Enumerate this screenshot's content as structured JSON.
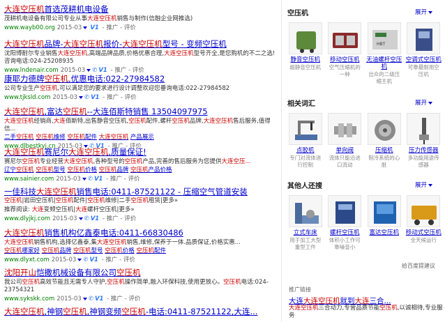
{
  "results": [
    {
      "title_parts": [
        "大连空压机",
        "首选茂耕机电设备"
      ],
      "title_hl": [
        0
      ],
      "desc_parts": [
        "茂耕机电设备有限公司专业从事",
        "大连空压机",
        "销售与制作(信融企业网推选)"
      ],
      "desc_hl": [
        1
      ],
      "url": "www.wayb00.org",
      "date": "2015-03",
      "v": "V1",
      "phone": false,
      "tools": [
        "推广",
        "评价"
      ],
      "links": []
    },
    {
      "title_parts": [
        "大连空压机",
        "品牌-",
        "大连空压机",
        "报价-",
        "大连空压机",
        "型号 - 变频空压机"
      ],
      "title_hl": [
        0,
        2,
        4
      ],
      "desc_parts": [
        "沈阳博耐尔专业销售",
        "大连空压机",
        ",高端品牌品质,价格优惠合理,",
        "大连空压机",
        "型号齐全,是您购机的不二之选!咨询电话:024-25208935"
      ],
      "desc_hl": [
        1,
        3
      ],
      "url": "www.lndenair.com",
      "date": "2015-03",
      "v": "V1",
      "phone": true,
      "tools": [
        "推广",
        "评价"
      ],
      "links": []
    },
    {
      "title_parts": [
        "康耶力德牌",
        "空压机",
        ",优惠电话:022-27984582"
      ],
      "title_hl": [
        1
      ],
      "desc_parts": [
        "公司专业生产",
        "空压机",
        ",可以满足您的要求进行设计调整欢迎您垂询电话:022-27984582"
      ],
      "desc_hl": [
        1
      ],
      "url": "www.tjksld.com",
      "date": "2015-03",
      "v": "V1",
      "phone": true,
      "tools": [
        "推广",
        "评价"
      ],
      "links": []
    },
    {
      "title_parts": [
        "大连空压机",
        ",富达",
        "空压机",
        "--大连佰斯特销售 13504097975"
      ],
      "title_hl": [
        0,
        2
      ],
      "desc_parts": [
        "大连空压机",
        "经销商,",
        "大连",
        "佰斯特,出售静音空压机,",
        "空压机",
        "配件,螺杆",
        "空压机",
        "品牌,",
        "大连空压机",
        "售后服务,值得信..."
      ],
      "desc_hl": [
        0,
        2,
        4,
        6,
        8
      ],
      "url": "www.dlbestkyj.cn",
      "date": "2015-03",
      "v": "V1",
      "phone": true,
      "tools": [
        "推广",
        "评价"
      ],
      "links": [
        [
          "二手",
          "空压机"
        ],
        [
          "空压机",
          "维修"
        ],
        [
          "空压机",
          "配件"
        ],
        [
          "大连空压机"
        ],
        [
          "产品展示"
        ]
      ]
    },
    {
      "title_parts": [
        "大连空压机",
        "赛尼尔",
        "大连空压机",
        ",质量保证!"
      ],
      "title_hl": [
        0,
        2
      ],
      "desc_parts": [
        "赛尼尔",
        "空压机",
        "专业经营",
        "大连空压机",
        ",各种型号的",
        "空压机",
        "产品,完善的售后服务为您提供",
        "大连空压..."
      ],
      "desc_hl": [
        1,
        3,
        5,
        7
      ],
      "url": "www.sainier.com",
      "date": "2015-03",
      "v": "V1",
      "phone": true,
      "tools": [
        "推广",
        "评价"
      ],
      "links": [
        [
          "辽宁",
          "空压机"
        ],
        [
          "空压机",
          "型号"
        ],
        [
          "空压机",
          "价格"
        ],
        [
          "空压机",
          "品牌"
        ],
        [
          "空压机",
          "产品价格"
        ]
      ]
    },
    {
      "title_parts": [
        "一佳科技",
        "大连空压机",
        "销售电话:0411-87521122 - 压缩空气管道安装"
      ],
      "title_hl": [
        1
      ],
      "desc_parts": [
        "空压机",
        "|岩田空压机|",
        "空压机",
        "配件|",
        "空压机",
        "维修|二手",
        "空压机",
        "租赁|更多»"
      ],
      "desc_hl": [
        0,
        2,
        4,
        6
      ],
      "desc_link": true,
      "extra_parts": [
        "推荐阅读: ",
        "大连",
        "变频空压机|",
        "大连",
        "螺杆空压机|更多»"
      ],
      "extra_hl": [
        1,
        3
      ],
      "url": "www.dlyjkj.com",
      "date": "2015-03",
      "v": "V1",
      "phone": true,
      "tools": [
        "推广",
        "评价"
      ],
      "links": []
    },
    {
      "title_parts": [
        "大连空压机",
        "销售机构亿鑫泰电话:0411-66830486"
      ],
      "title_hl": [
        0
      ],
      "desc_parts": [
        "大连空压机",
        "销售机构,选择亿鑫泰,集",
        "大连空压机",
        "销售,维修,保养于一体.品质保证,价格实惠..."
      ],
      "desc_hl": [
        0,
        2
      ],
      "url": "www.dlyxt.com",
      "date": "2015-03",
      "v": "V1",
      "phone": true,
      "tools": [
        "推广",
        "评价"
      ],
      "links": [
        [
          "空压机",
          "哪家好"
        ],
        [
          "空压机",
          "品牌"
        ],
        [
          "空压机",
          "型号"
        ],
        [
          "空压机",
          "价格"
        ],
        [
          "空压机",
          "配件"
        ]
      ]
    },
    {
      "title_parts": [
        "沈阳开山",
        "恺撒机械设备有限公司",
        "空压机"
      ],
      "title_hl": [
        0,
        2
      ],
      "desc_parts": [
        "我公司",
        "空压机",
        "高效节能且无需专人守护,",
        "空压机",
        "操作简单,融入环保科技,使用更放心。",
        "空压机",
        "电话:024-23754321"
      ],
      "desc_hl": [
        1,
        3,
        5
      ],
      "url": "www.sykskk.com",
      "date": "2015-03",
      "v": "V1",
      "phone": true,
      "tools": [
        "推广",
        "评价"
      ],
      "links": []
    },
    {
      "title_parts": [
        "大连空压机",
        ",神钢",
        "空压机",
        ",神钢变频",
        "空压机",
        "-电话:0411-87521122,大连..."
      ],
      "title_hl": [
        0,
        2,
        4
      ],
      "desc_parts": [],
      "desc_hl": [],
      "url": "",
      "date": "",
      "v": "",
      "phone": false,
      "tools": [],
      "links": []
    }
  ],
  "sidebar": {
    "sections": [
      {
        "title": "空压机",
        "expand": "展开",
        "items": [
          {
            "name": "静音空压机",
            "sub": "超静音空压机",
            "icon": "silent-compressor-icon",
            "color": "#5d8a3a"
          },
          {
            "name": "移动空压机",
            "sub": "空气压缩机的一种",
            "icon": "mobile-compressor-icon",
            "color": "#8a2b2b"
          },
          {
            "name": "无油螺杆空压机",
            "sub": "出众的二级压缩主机",
            "icon": "oilfree-screw-compressor-icon",
            "color": "#777777"
          },
          {
            "name": "空调式空压机",
            "sub": "可靠最耐用空压机",
            "icon": "ac-compressor-icon",
            "color": "#3a4f8a"
          }
        ]
      },
      {
        "title": "相关词汇",
        "expand": "展开",
        "items": [
          {
            "name": "点胶机",
            "sub": "专门对流体进行控制",
            "icon": "dispenser-icon",
            "color": "#4b6ea8"
          },
          {
            "name": "单向阀",
            "sub": "流体只能沿进口流动",
            "icon": "check-valve-icon",
            "color": "#9a9a9a"
          },
          {
            "name": "压缩机",
            "sub": "制冷系统的心脏",
            "icon": "compressor-icon",
            "color": "#8a8a8a"
          },
          {
            "name": "压力传感器",
            "sub": "多功能用途传感器",
            "icon": "pressure-sensor-icon",
            "color": "#555555"
          }
        ]
      },
      {
        "title": "其他人还搜",
        "expand": "展开",
        "items": [
          {
            "name": "立式车床",
            "sub": "用于加工大型重型工件",
            "icon": "vertical-lathe-icon",
            "color": "#4a6a9a"
          },
          {
            "name": "螺杆空压机",
            "sub": "体积小工作可靠噪音小",
            "icon": "screw-compressor-icon",
            "color": "#2c4a8a"
          },
          {
            "name": "富达空压机",
            "sub": "",
            "icon": "fuda-compressor-icon",
            "color": "#1f63b0"
          },
          {
            "name": "移动式空压机",
            "sub": "全天候运行",
            "icon": "portable-compressor-icon",
            "color": "#d99a1a"
          }
        ]
      }
    ],
    "feedback": "给百度提建议",
    "ad": {
      "label": "推广链接",
      "title_parts": [
        "大连",
        "大连",
        "空压机",
        "就到",
        "大连",
        "三合..."
      ],
      "title_hl": [
        1,
        2,
        4
      ],
      "desc_parts": [
        "大连空压机",
        "三合动力,专营品质节能",
        "空压机",
        ",以诚相待,专业服务"
      ],
      "desc_hl": [
        0,
        2
      ]
    }
  },
  "colors": {
    "link": "#0000cc",
    "highlight": "#cc0000",
    "url": "#008000",
    "muted": "#666666"
  }
}
